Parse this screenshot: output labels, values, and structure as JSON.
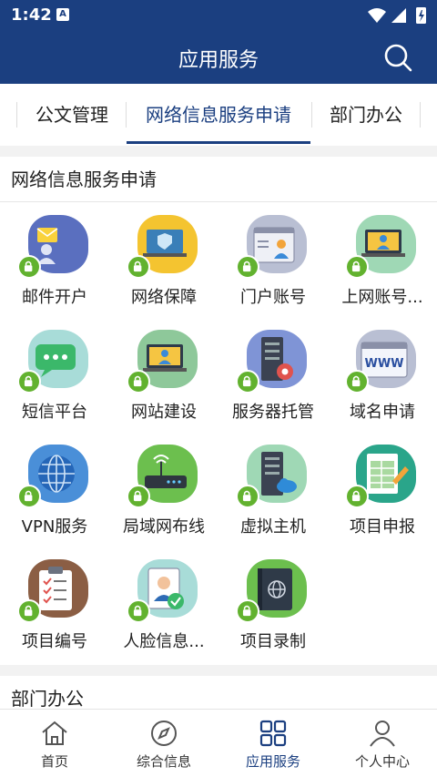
{
  "status_bar": {
    "time": "1:42",
    "notification_letter": "A"
  },
  "header": {
    "title": "应用服务"
  },
  "tabs": [
    {
      "label": "公文管理"
    },
    {
      "label": "网络信息服务申请"
    },
    {
      "label": "部门办公"
    }
  ],
  "section": {
    "title": "网络信息服务申请",
    "items": [
      {
        "label": "邮件开户",
        "icon": "mail-icon",
        "color": "#5a6fbf"
      },
      {
        "label": "网络保障",
        "icon": "shield-laptop-icon",
        "color": "#f4c430"
      },
      {
        "label": "门户账号",
        "icon": "portal-icon",
        "color": "#b9bfd3"
      },
      {
        "label": "上网账号...",
        "icon": "laptop-user-icon",
        "color": "#9fd8b5"
      },
      {
        "label": "短信平台",
        "icon": "sms-icon",
        "color": "#a8dcd8"
      },
      {
        "label": "网站建设",
        "icon": "website-icon",
        "color": "#8ec89a"
      },
      {
        "label": "服务器托管",
        "icon": "server-gear-icon",
        "color": "#7f94d6"
      },
      {
        "label": "域名申请",
        "icon": "www-icon",
        "color": "#b9bfd3"
      },
      {
        "label": "VPN服务",
        "icon": "globe-icon",
        "color": "#4a8fd8"
      },
      {
        "label": "局域网布线",
        "icon": "router-icon",
        "color": "#6cbf4e"
      },
      {
        "label": "虚拟主机",
        "icon": "server-cloud-icon",
        "color": "#9fd8b5"
      },
      {
        "label": "项目申报",
        "icon": "spreadsheet-icon",
        "color": "#2aa58a"
      },
      {
        "label": "项目编号",
        "icon": "clipboard-icon",
        "color": "#8b5e44"
      },
      {
        "label": "人脸信息...",
        "icon": "face-id-icon",
        "color": "#a8dcd8"
      },
      {
        "label": "项目录制",
        "icon": "book-globe-icon",
        "color": "#6cbf4e"
      }
    ]
  },
  "next_section": {
    "title": "部门办公"
  },
  "bottom_nav": [
    {
      "label": "首页",
      "icon": "home-icon"
    },
    {
      "label": "综合信息",
      "icon": "compass-icon"
    },
    {
      "label": "应用服务",
      "icon": "grid-icon"
    },
    {
      "label": "个人中心",
      "icon": "user-icon"
    }
  ]
}
